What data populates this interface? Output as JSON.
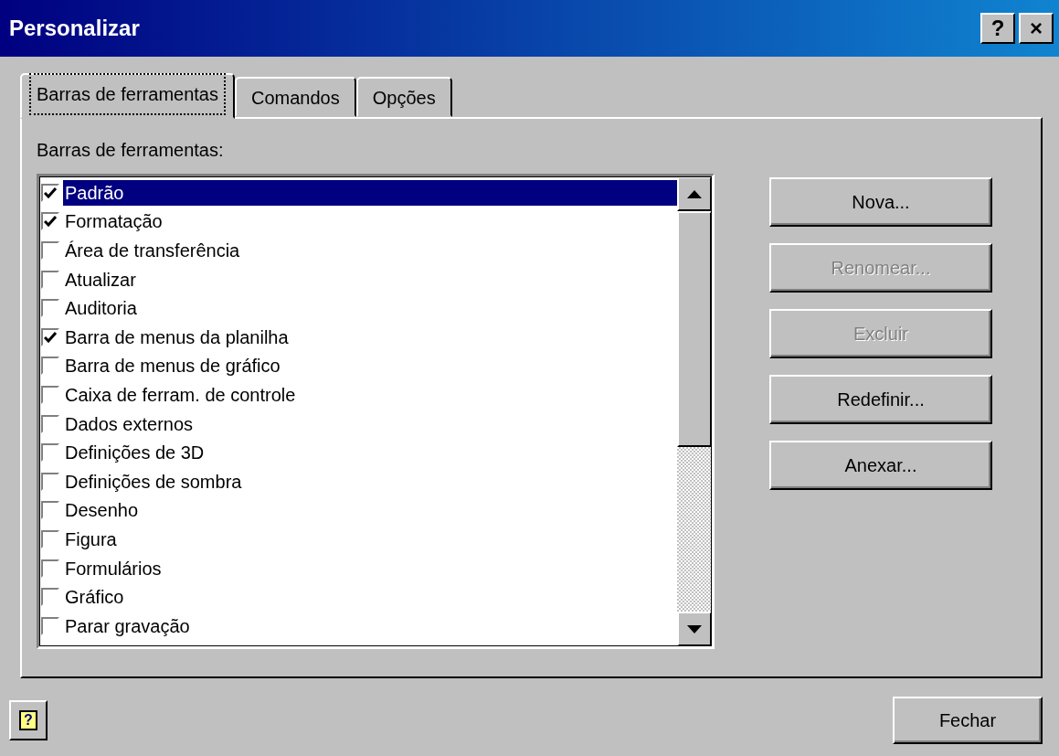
{
  "window": {
    "title": "Personalizar",
    "title_buttons": [
      "?",
      "×"
    ]
  },
  "tabs": [
    {
      "label": "Barras de ferramentas",
      "selected": true
    },
    {
      "label": "Comandos",
      "selected": false
    },
    {
      "label": "Opções",
      "selected": false
    }
  ],
  "list_label": "Barras de ferramentas:",
  "toolbars": [
    {
      "label": "Padrão",
      "checked": true,
      "selected": true
    },
    {
      "label": "Formatação",
      "checked": true,
      "selected": false
    },
    {
      "label": "Área de transferência",
      "checked": false,
      "selected": false
    },
    {
      "label": "Atualizar",
      "checked": false,
      "selected": false
    },
    {
      "label": "Auditoria",
      "checked": false,
      "selected": false
    },
    {
      "label": "Barra de menus da planilha",
      "checked": true,
      "selected": false
    },
    {
      "label": "Barra de menus de gráfico",
      "checked": false,
      "selected": false
    },
    {
      "label": "Caixa de ferram. de controle",
      "checked": false,
      "selected": false
    },
    {
      "label": "Dados externos",
      "checked": false,
      "selected": false
    },
    {
      "label": "Definições de 3D",
      "checked": false,
      "selected": false
    },
    {
      "label": "Definições de sombra",
      "checked": false,
      "selected": false
    },
    {
      "label": "Desenho",
      "checked": false,
      "selected": false
    },
    {
      "label": "Figura",
      "checked": false,
      "selected": false
    },
    {
      "label": "Formulários",
      "checked": false,
      "selected": false
    },
    {
      "label": "Gráfico",
      "checked": false,
      "selected": false
    },
    {
      "label": "Parar gravação",
      "checked": false,
      "selected": false
    }
  ],
  "buttons": [
    {
      "label": "Nova...",
      "disabled": false
    },
    {
      "label": "Renomear...",
      "disabled": true
    },
    {
      "label": "Excluir",
      "disabled": true
    },
    {
      "label": "Redefinir...",
      "disabled": false
    },
    {
      "label": "Anexar...",
      "disabled": false
    }
  ],
  "help_button": "?",
  "close_button": "Fechar"
}
